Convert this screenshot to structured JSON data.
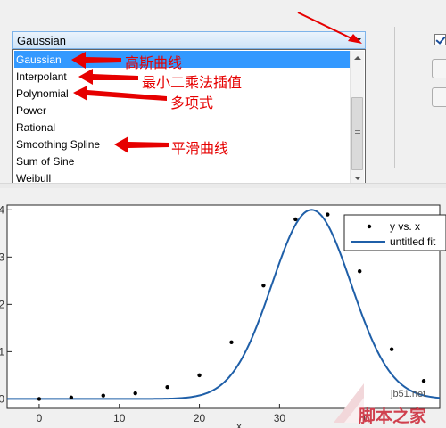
{
  "combo": {
    "value": "Gaussian"
  },
  "list": {
    "items": [
      {
        "label": "Gaussian",
        "selected": true
      },
      {
        "label": "Interpolant",
        "selected": false
      },
      {
        "label": "Polynomial",
        "selected": false
      },
      {
        "label": "Power",
        "selected": false
      },
      {
        "label": "Rational",
        "selected": false
      },
      {
        "label": "Smoothing Spline",
        "selected": false
      },
      {
        "label": "Sum of Sine",
        "selected": false
      },
      {
        "label": "Weibull",
        "selected": false
      }
    ]
  },
  "annotations": {
    "gaussian": "高斯曲线",
    "interpolant": "最小二乘法插值",
    "polynomial": "多项式",
    "smoothing_spline": "平滑曲线"
  },
  "colors": {
    "annotation": "#e60000",
    "selection": "#3399ff",
    "fit_line": "#1f5fa8"
  },
  "chart_data": {
    "type": "scatter",
    "xlabel": "x",
    "xlim": [
      -4,
      50
    ],
    "ylim": [
      -0.2,
      4.1
    ],
    "xticks": [
      0,
      10,
      20,
      30,
      40
    ],
    "yticks": [
      0,
      1,
      2,
      3,
      4
    ],
    "grid": false,
    "legend_position": "top-right",
    "series": [
      {
        "name": "y vs. x",
        "kind": "points",
        "x": [
          0,
          4,
          8,
          12,
          16,
          20,
          24,
          28,
          32,
          36,
          40,
          44,
          48
        ],
        "y": [
          0.0,
          0.03,
          0.07,
          0.12,
          0.25,
          0.5,
          1.2,
          2.4,
          3.8,
          3.9,
          2.7,
          1.05,
          0.38
        ]
      },
      {
        "name": "untitled fit",
        "kind": "line",
        "model": "gauss1",
        "a": 4.0,
        "b": 34.0,
        "c": 7.0,
        "x_range": [
          -4,
          50
        ]
      }
    ]
  },
  "watermark": {
    "url": "jb51.net",
    "brand": "脚本之家"
  }
}
